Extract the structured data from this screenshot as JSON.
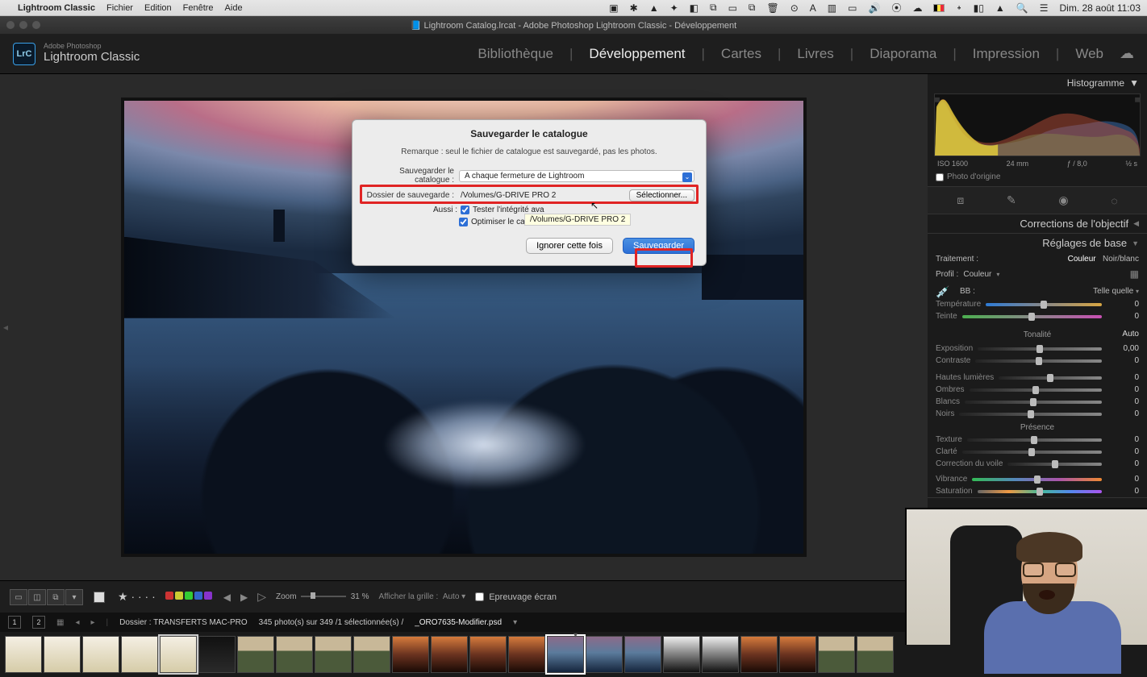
{
  "menubar": {
    "app": "Lightroom Classic",
    "items": [
      "Fichier",
      "Edition",
      "Fenêtre",
      "Aide"
    ],
    "clock": "Dim. 28 août  11:03"
  },
  "window": {
    "title": "Lightroom Catalog.lrcat - Adobe Photoshop Lightroom Classic - Développement"
  },
  "brand": {
    "small": "Adobe Photoshop",
    "big": "Lightroom Classic",
    "logo": "LrC"
  },
  "modules": {
    "items": [
      "Bibliothèque",
      "Développement",
      "Cartes",
      "Livres",
      "Diaporama",
      "Impression",
      "Web"
    ],
    "active_index": 1
  },
  "dialog": {
    "title": "Sauvegarder le catalogue",
    "note": "Remarque : seul le fichier de catalogue est sauvegardé, pas les photos.",
    "schedule_label": "Sauvegarder le catalogue :",
    "schedule_value": "A chaque fermeture de Lightroom",
    "folder_label": "Dossier de sauvegarde :",
    "folder_value": "/Volumes/G-DRIVE PRO 2",
    "select_btn": "Sélectionner...",
    "also_label": "Aussi :",
    "chk1": "Tester l'intégrité avant la sauvegarde",
    "chk1_short": "Tester l'intégrité ava",
    "chk2": "Optimiser le catalogue après la sauvegarde",
    "skip_btn": "Ignorer cette fois",
    "save_btn": "Sauvegarder",
    "tooltip": "/Volumes/G-DRIVE PRO 2"
  },
  "right": {
    "histogram_label": "Histogramme",
    "meta": {
      "iso": "ISO 1600",
      "focal": "24 mm",
      "aperture": "ƒ / 8,0",
      "shutter": "½ s"
    },
    "origin": "Photo d'origine",
    "lens_section": "Corrections de l'objectif",
    "basic_section": "Réglages de base",
    "treatment_label": "Traitement :",
    "treatment_color": "Couleur",
    "treatment_bw": "Noir/blanc",
    "profile_label": "Profil :",
    "profile_value": "Couleur",
    "bb_label": "BB :",
    "bb_value": "Telle quelle",
    "sliders": {
      "temperature": {
        "label": "Température",
        "value": "0"
      },
      "tint": {
        "label": "Teinte",
        "value": "0"
      }
    },
    "tone_title": "Tonalité",
    "auto": "Auto",
    "tone": {
      "exposure": {
        "label": "Exposition",
        "value": "0,00"
      },
      "contrast": {
        "label": "Contraste",
        "value": "0"
      },
      "highlights": {
        "label": "Hautes lumières",
        "value": "0"
      },
      "shadows": {
        "label": "Ombres",
        "value": "0"
      },
      "whites": {
        "label": "Blancs",
        "value": "0"
      },
      "blacks": {
        "label": "Noirs",
        "value": "0"
      }
    },
    "presence_title": "Présence",
    "presence": {
      "texture": {
        "label": "Texture",
        "value": "0"
      },
      "clarity": {
        "label": "Clarté",
        "value": "0"
      },
      "dehaze": {
        "label": "Correction du voile",
        "value": "0"
      },
      "vibrance": {
        "label": "Vibrance",
        "value": "0"
      },
      "saturation": {
        "label": "Saturation",
        "value": "0"
      }
    }
  },
  "toolbar": {
    "zoom_label": "Zoom",
    "zoom_value": "31 %",
    "grid_label": "Afficher la grille :",
    "grid_value": "Auto",
    "softproof": "Epreuvage écran"
  },
  "infobar": {
    "n1": "1",
    "n2": "2",
    "folder": "Dossier : TRANSFERTS MAC-PRO",
    "count": "345 photo(s) sur 349 /1 sélectionnée(s) /",
    "filename": "_ORO7635-Modifier.psd"
  }
}
